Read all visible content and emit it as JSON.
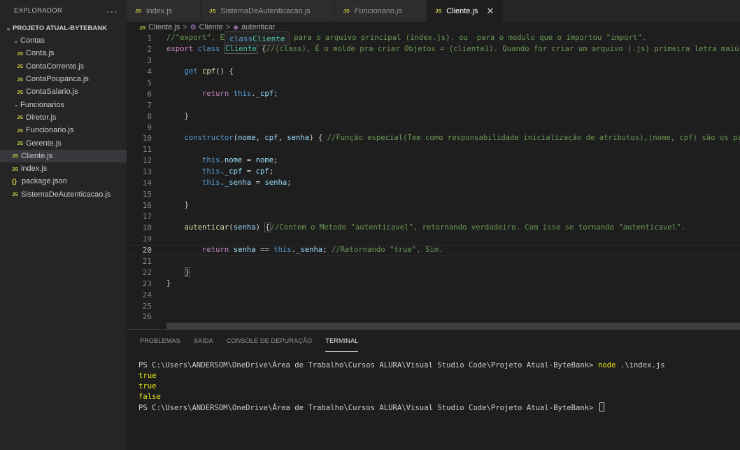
{
  "sidebar": {
    "title": "EXPLORADOR",
    "more": "···",
    "project": "PROJETO ATUAL-BYTEBANK",
    "items": [
      {
        "label": "Contas",
        "type": "folder"
      },
      {
        "label": "Conta.js",
        "type": "js"
      },
      {
        "label": "ContaCorrente.js",
        "type": "js"
      },
      {
        "label": "ContaPoupanca.js",
        "type": "js"
      },
      {
        "label": "ContaSalario.js",
        "type": "js"
      },
      {
        "label": "Funcionarios",
        "type": "folder"
      },
      {
        "label": "Diretor.js",
        "type": "js"
      },
      {
        "label": "Funcionario.js",
        "type": "js"
      },
      {
        "label": "Gerente.js",
        "type": "js"
      },
      {
        "label": "Cliente.js",
        "type": "js"
      },
      {
        "label": "index.js",
        "type": "js"
      },
      {
        "label": "package.json",
        "type": "json"
      },
      {
        "label": "SistemaDeAutenticacao.js",
        "type": "js"
      }
    ]
  },
  "icons": {
    "js": "JS",
    "json": "{}"
  },
  "tabs": [
    {
      "label": "index.js"
    },
    {
      "label": "SistemaDeAutenticacao.js"
    },
    {
      "label": "Funcionario.js"
    },
    {
      "label": "Cliente.js",
      "close": "✕"
    }
  ],
  "breadcrumb": {
    "file": "Cliente.js",
    "class": "Cliente",
    "method": "autenticar",
    "sep": ">"
  },
  "hover": {
    "keyword": "class",
    "name": "Cliente"
  },
  "editor": {
    "line_numbers": [
      "1",
      "2",
      "3",
      "4",
      "5",
      "6",
      "7",
      "8",
      "9",
      "10",
      "11",
      "12",
      "13",
      "14",
      "15",
      "16",
      "17",
      "18",
      "19",
      "20",
      "21",
      "22",
      "23",
      "24",
      "25",
      "26"
    ],
    "current_line": "20",
    "lines": {
      "l1_a": "//\"export\", E",
      "l1_b": " para o arquivo principal (index.js). ou  para o modulo que o importou \"import\".",
      "l2_export": "export",
      "l2_class": "class",
      "l2_name": "Cliente",
      "l2_brace": " {",
      "l2_comment": "//(class), É o molde pra criar Objetos = (cliente1). Quando for criar um arquivo (.js) primeira letra maiúscula",
      "l4_get": "get",
      "l4_fn": "cpf",
      "l4_rest": "() {",
      "l6_return": "return",
      "l6_this": "this",
      "l6_rest": "._cpf;",
      "close_brace": "}",
      "l10_ctor": "constructor",
      "l10_p1": "nome",
      "l10_p2": "cpf",
      "l10_p3": "senha",
      "l10_comment": "//Função especial(Tem como responsabilidade inicialização de atributos),(nome, cpf) são os parâmetros",
      "l12_a": "this",
      "l12_b": ".nome",
      "l12_c": "nome",
      "l13_b": "._cpf",
      "l13_c": "cpf",
      "l14_b": "._senha",
      "l14_c": "senha",
      "l18_fn": "autenticar",
      "l18_p": "senha",
      "l18_comment": "//Contem o Metodo \"autenticavel\", retornando verdadeiro. Com isso se tornando \"autenticavel\".",
      "l20_return": "return",
      "l20_a": "senha",
      "l20_op": " == ",
      "l20_this": "this",
      "l20_b": "._senha",
      "l20_comment": "//Retornando \"true\", Sim."
    }
  },
  "panel": {
    "tabs": [
      "PROBLEMAS",
      "SAÍDA",
      "CONSOLE DE DEPURAÇÃO",
      "TERMINAL"
    ],
    "prompt": "PS C:\\Users\\ANDERSOM\\OneDrive\\Área de Trabalho\\Cursos ALURA\\Visual Studio Code\\Projeto Atual-ByteBank> ",
    "command": "node",
    "command_arg": " .\\index.js",
    "output": [
      "true",
      "true",
      "false"
    ],
    "prompt2": "PS C:\\Users\\ANDERSOM\\OneDrive\\Área de Trabalho\\Cursos ALURA\\Visual Studio Code\\Projeto Atual-ByteBank> "
  }
}
